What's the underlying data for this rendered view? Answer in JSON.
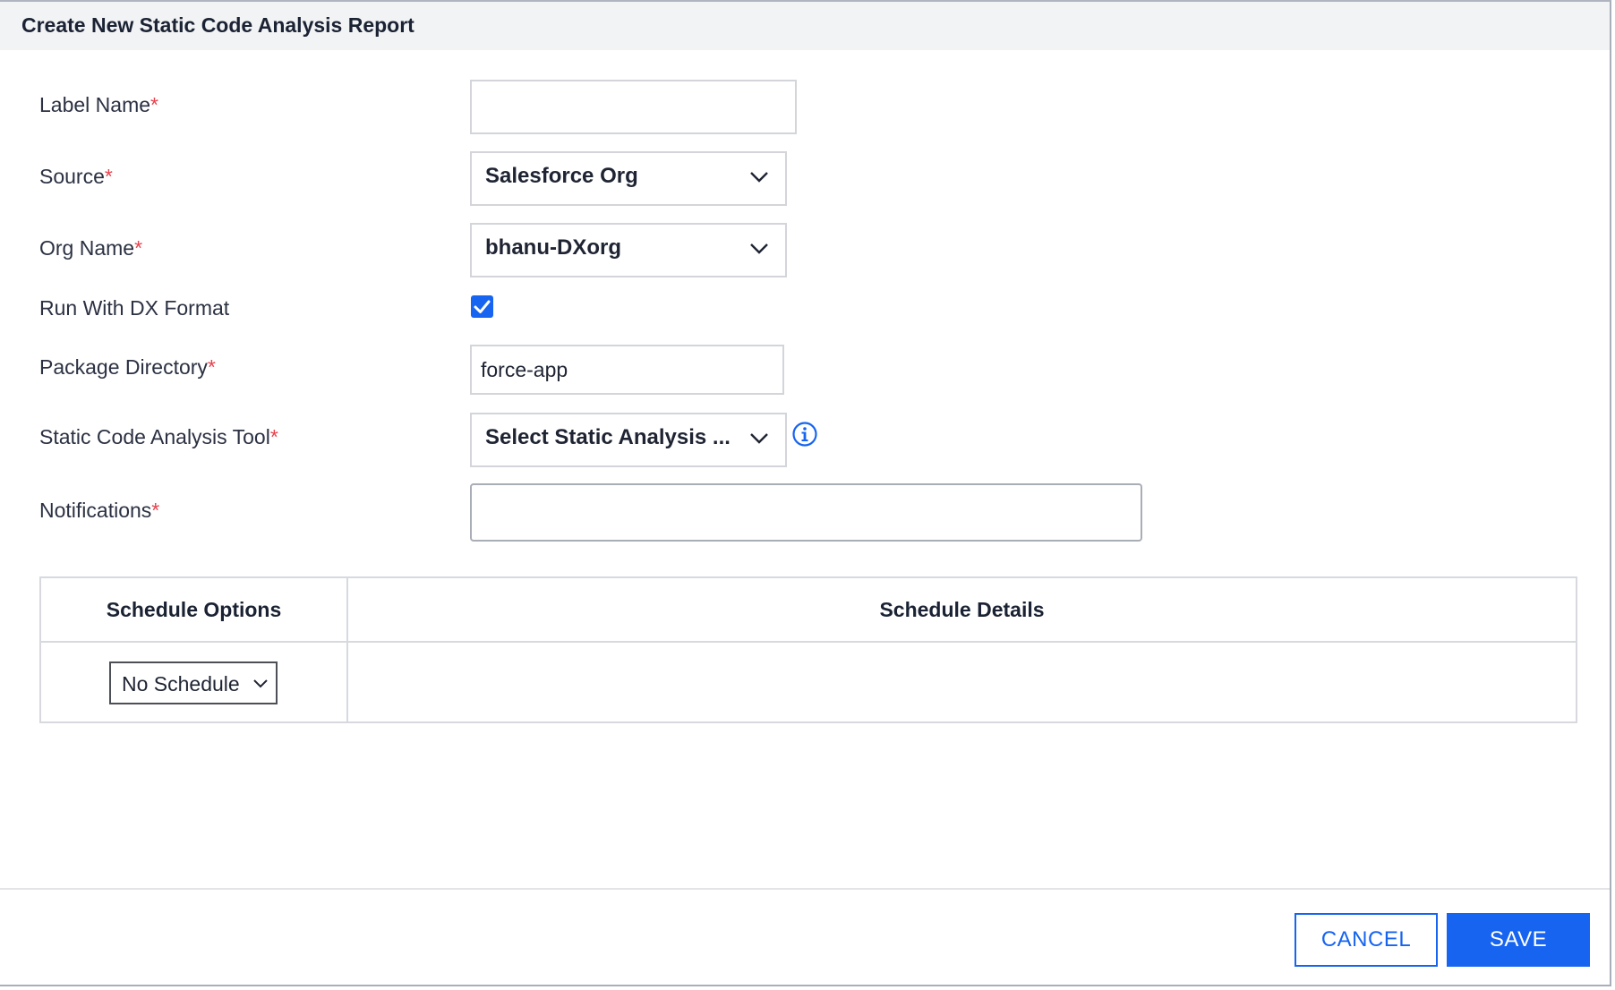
{
  "dialog": {
    "title": "Create New Static Code Analysis Report"
  },
  "form": {
    "required_marker": "*",
    "label_name": {
      "label": "Label Name",
      "value": "",
      "placeholder": ""
    },
    "source": {
      "label": "Source",
      "selected": "Salesforce Org"
    },
    "org_name": {
      "label": "Org Name",
      "selected": "bhanu-DXorg"
    },
    "run_with_dx": {
      "label": "Run With DX Format",
      "checked": true
    },
    "package_directory": {
      "label": "Package Directory",
      "value": "force-app"
    },
    "static_tool": {
      "label": "Static Code Analysis Tool",
      "selected": "Select Static Analysis ..."
    },
    "notifications": {
      "label": "Notifications",
      "value": ""
    }
  },
  "schedule": {
    "options_header": "Schedule Options",
    "details_header": "Schedule Details",
    "selected": "No Schedule"
  },
  "footer": {
    "cancel_label": "CANCEL",
    "save_label": "SAVE"
  },
  "colors": {
    "accent": "#1664f0",
    "required": "#e6424d",
    "header_bg": "#f2f3f5"
  },
  "icons": {
    "dropdown": "chevron-down-icon",
    "info": "info-icon",
    "check": "checkmark-icon"
  }
}
